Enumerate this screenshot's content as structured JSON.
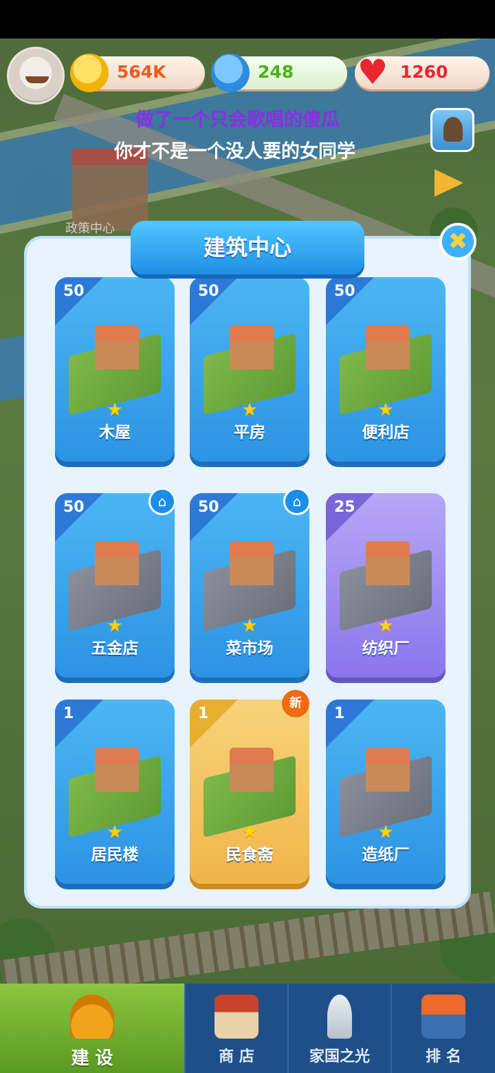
{
  "hud": {
    "coins": "564K",
    "stars": "248",
    "hearts": "1260",
    "lyric_line1": "做了一个只会歌唱的傻瓜",
    "lyric_line2": "你才不是一个没人要的女同学",
    "map_label": "政策中心"
  },
  "modal": {
    "title": "建筑中心",
    "close_icon": "✖",
    "cards": [
      {
        "num": "50",
        "label": "木屋",
        "style": "blue"
      },
      {
        "num": "50",
        "label": "平房",
        "style": "blue"
      },
      {
        "num": "50",
        "label": "便利店",
        "style": "blue"
      },
      {
        "num": "50",
        "label": "五金店",
        "style": "blue",
        "home_badge": true
      },
      {
        "num": "50",
        "label": "菜市场",
        "style": "blue",
        "home_badge": true
      },
      {
        "num": "25",
        "label": "纺织厂",
        "style": "purple"
      },
      {
        "num": "1",
        "label": "居民楼",
        "style": "blue"
      },
      {
        "num": "1",
        "label": "民食斋",
        "style": "gold",
        "badge": "新"
      },
      {
        "num": "1",
        "label": "造纸厂",
        "style": "blue"
      }
    ]
  },
  "bottom_nav": {
    "items": [
      {
        "label": "建 设",
        "icon": "hardhat-icon",
        "active": true
      },
      {
        "label": "商 店",
        "icon": "shop-icon"
      },
      {
        "label": "家国之光",
        "icon": "rocket-icon"
      },
      {
        "label": "排 名",
        "icon": "ranking-icon"
      }
    ]
  },
  "colors": {
    "card_blue": "#2d93e4",
    "card_purple": "#8a76ec",
    "card_gold": "#f0b54a",
    "lyric_highlight": "#8a2ee6",
    "nav_active": "#6aa82a"
  }
}
